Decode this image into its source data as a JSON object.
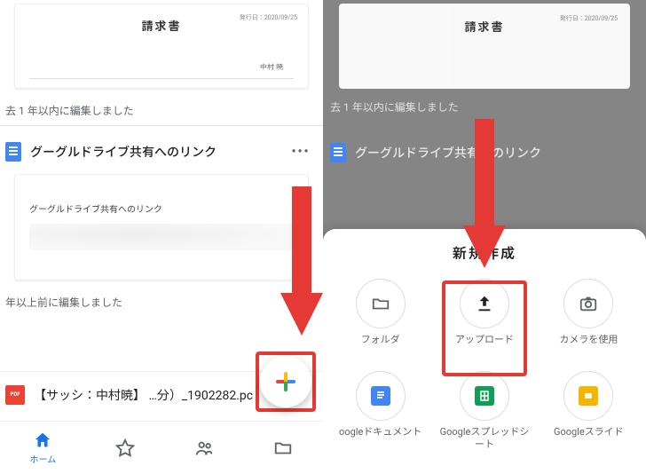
{
  "left": {
    "invoice_thumb": {
      "title": "請求書",
      "date": "発行日：2020/09/25",
      "name": "中村 暁"
    },
    "meta1": "去 1 年以内に編集しました",
    "doc_row": {
      "name": "グーグルドライブ共有へのリンク",
      "more": "•••"
    },
    "plain_thumb": {
      "title": "グーグルドライブ共有へのリンク"
    },
    "meta2": "年以上前に編集しました",
    "pdf": {
      "badge": "PDF",
      "name": "【サッシ：中村暁】 …分）_1902282.pc"
    },
    "tabs": {
      "home": "ホーム",
      "star": "",
      "shared": "",
      "files": ""
    }
  },
  "right": {
    "invoice_thumb": {
      "title": "請求書",
      "date": "発行日：2020/09/25"
    },
    "ghost_meta": "去 1 年以内に編集しました",
    "ghost_row_name": "グーグルドライブ共有へのリンク",
    "sheet": {
      "title": "新規作成",
      "items": {
        "folder": {
          "label": "フォルダ"
        },
        "upload": {
          "label": "アップロード"
        },
        "camera": {
          "label": "カメラを使用"
        },
        "gdoc": {
          "label": "oogleドキュメント"
        },
        "gsheet": {
          "label": "Googleスプレッドシート"
        },
        "gslide": {
          "label": "Googleスライド"
        }
      }
    }
  }
}
